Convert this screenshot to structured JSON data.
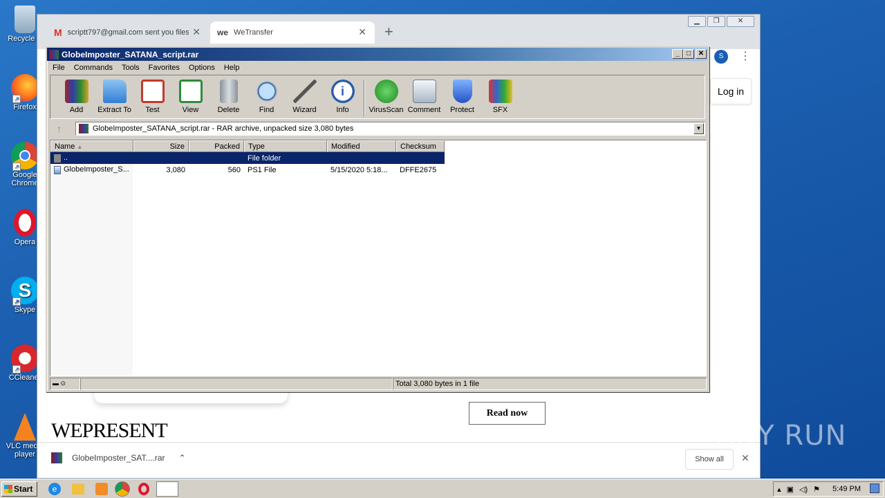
{
  "desktop": {
    "icons": [
      {
        "label": "Recycle B"
      },
      {
        "label": "Firefox"
      },
      {
        "label": "Google Chrome"
      },
      {
        "label": "Opera"
      },
      {
        "label": "Skype"
      },
      {
        "label": "CCleaner"
      },
      {
        "label": "VLC media player"
      }
    ]
  },
  "browser": {
    "tabs": [
      {
        "label": "scriptt797@gmail.com sent you files"
      },
      {
        "label": "WeTransfer"
      }
    ],
    "new_tab": "+",
    "avatar": "S",
    "page": {
      "login": "Log in",
      "read_now": "Read now",
      "brand": "WEPRESENT"
    },
    "download": {
      "filename": "GlobeImposter_SAT....rar",
      "show_all": "Show all"
    }
  },
  "winrar": {
    "title": "GlobeImposter_SATANA_script.rar",
    "menu": [
      "File",
      "Commands",
      "Tools",
      "Favorites",
      "Options",
      "Help"
    ],
    "tools": [
      "Add",
      "Extract To",
      "Test",
      "View",
      "Delete",
      "Find",
      "Wizard",
      "Info",
      "VirusScan",
      "Comment",
      "Protect",
      "SFX"
    ],
    "address": "GlobeImposter_SATANA_script.rar - RAR archive, unpacked size 3,080 bytes",
    "columns": [
      "Name",
      "Size",
      "Packed",
      "Type",
      "Modified",
      "Checksum"
    ],
    "rows": [
      {
        "name": "..",
        "size": "",
        "packed": "",
        "type": "File folder",
        "modified": "",
        "checksum": ""
      },
      {
        "name": "GlobeImposter_S...",
        "size": "3,080",
        "packed": "560",
        "type": "PS1 File",
        "modified": "5/15/2020 5:18...",
        "checksum": "DFFE2675"
      }
    ],
    "status": "Total 3,080 bytes in 1 file"
  },
  "taskbar": {
    "start": "Start",
    "clock": "5:49 PM"
  },
  "watermark": "ANY RUN",
  "colors": {
    "titlebar": "#0a246a",
    "selection": "#0a246a",
    "desktop": "#1c5fb0",
    "chrome_avatar": "#1a5fb4"
  }
}
